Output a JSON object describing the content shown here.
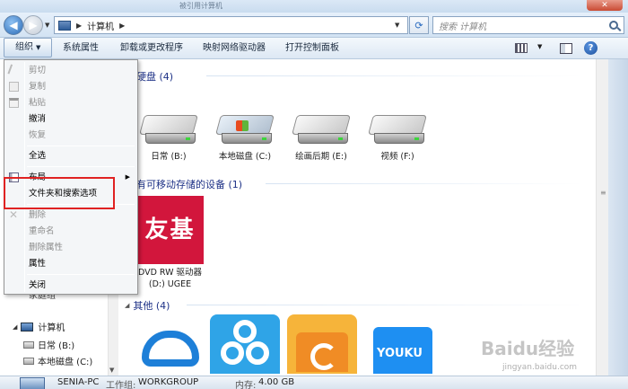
{
  "window": {
    "title": "被引用计算机"
  },
  "address": {
    "path": "计算机"
  },
  "search": {
    "placeholder": "搜索 计算机"
  },
  "toolbar": {
    "organize": "组织",
    "system_properties": "系统属性",
    "uninstall": "卸载或更改程序",
    "map_drive": "映射网络驱动器",
    "control_panel": "打开控制面板"
  },
  "context_menu": {
    "items": [
      {
        "label": "剪切",
        "enabled": false,
        "icon": "cut-icon"
      },
      {
        "label": "复制",
        "enabled": false,
        "icon": "copy-icon"
      },
      {
        "label": "粘贴",
        "enabled": false,
        "icon": "paste-icon"
      },
      {
        "label": "撤消",
        "enabled": true
      },
      {
        "label": "恢复",
        "enabled": false
      },
      {
        "label": "全选",
        "enabled": true
      },
      {
        "label": "布局",
        "enabled": true,
        "icon": "layout-icon",
        "submenu": true
      },
      {
        "label": "文件夹和搜索选项",
        "enabled": true
      },
      {
        "label": "删除",
        "enabled": false,
        "icon": "delete-icon"
      },
      {
        "label": "重命名",
        "enabled": false
      },
      {
        "label": "删除属性",
        "enabled": false
      },
      {
        "label": "属性",
        "enabled": true
      },
      {
        "label": "关闭",
        "enabled": true
      }
    ]
  },
  "navpane": {
    "homegroup": "家庭组",
    "computer": "计算机",
    "drive1": "日常 (B:)",
    "drive2": "本地磁盘 (C:)"
  },
  "groups": {
    "hdd": "硬盘 (4)",
    "removable": "有可移动存储的设备 (1)",
    "other": "其他 (4)"
  },
  "drives": [
    {
      "label": "日常 (B:)"
    },
    {
      "label": "本地磁盘 (C:)"
    },
    {
      "label": "绘画后期 (E:)"
    },
    {
      "label": "视频 (F:)"
    }
  ],
  "dvd": {
    "icon_text": "友基",
    "line1": "DVD RW 驱动器",
    "line2": "(D:) UGEE"
  },
  "apps": [
    {
      "icon": "baidu-cloud-icon"
    },
    {
      "icon": "baidu-netdisk-icon"
    },
    {
      "icon": "folder-app-icon"
    },
    {
      "icon": "youku-icon",
      "text": "YOUKU"
    }
  ],
  "status": {
    "pc_name": "SENIA-PC",
    "workgroup_label": "工作组:",
    "workgroup": "WORKGROUP",
    "memory_label": "内存:",
    "memory": "4.00 GB"
  },
  "watermark": {
    "brand": "Baidu经验",
    "url": "jingyan.baidu.com"
  },
  "colors": {
    "highlight_box": "#e02222",
    "group_header": "#1e3287",
    "dvd_bg": "#d2163c"
  }
}
